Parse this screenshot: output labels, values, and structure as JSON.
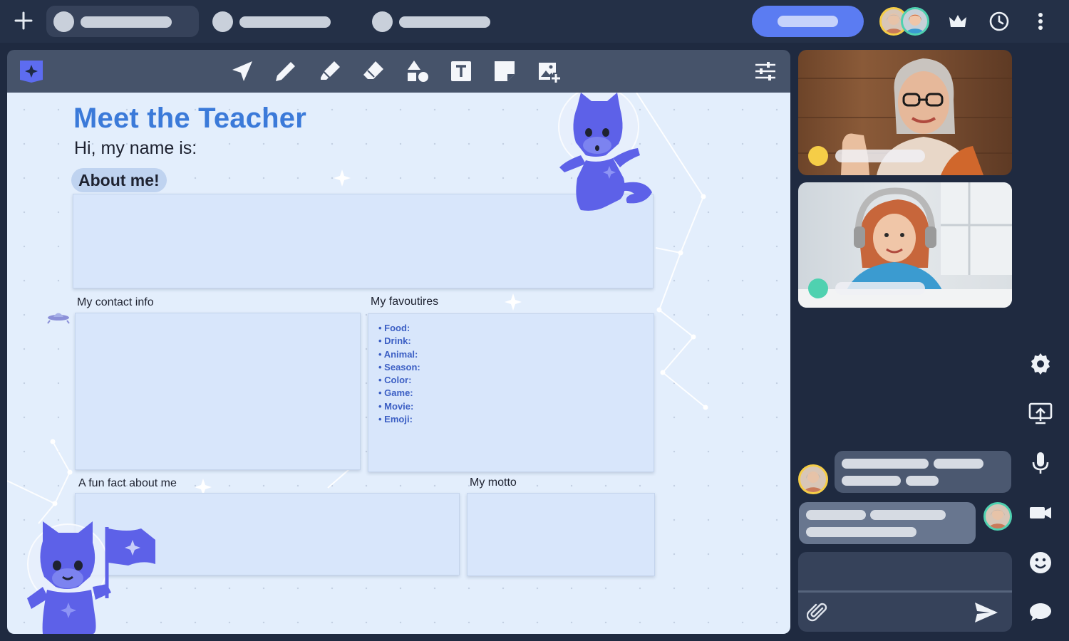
{
  "topbar": {
    "add_label": "+",
    "tabs": [
      "",
      "",
      ""
    ]
  },
  "board": {
    "title": "Meet the Teacher",
    "subtitle": "Hi, my name is:",
    "about_label": "About me!",
    "contact_label": "My contact info",
    "favourites_label": "My favoutires",
    "favourites": [
      "Food:",
      "Drink:",
      "Animal:",
      "Season:",
      "Color:",
      "Game:",
      "Movie:",
      "Emoji:"
    ],
    "fun_fact_label": "A fun fact about me",
    "motto_label": "My motto"
  },
  "colors": {
    "accent": "#5b7cf2",
    "title": "#3b7ad9",
    "participant_1": "#f5cd47",
    "participant_2": "#4fd1b0",
    "mascot": "#5d61e8"
  },
  "icons": {
    "toolbar": [
      "select-icon",
      "pen-icon",
      "highlighter-icon",
      "eraser-icon",
      "shapes-icon",
      "text-icon",
      "sticky-note-icon",
      "add-image-icon",
      "settings-sliders-icon"
    ],
    "sidebar": [
      "gear-icon",
      "screen-share-icon",
      "microphone-icon",
      "camera-icon",
      "emoji-icon",
      "chat-icon"
    ]
  }
}
